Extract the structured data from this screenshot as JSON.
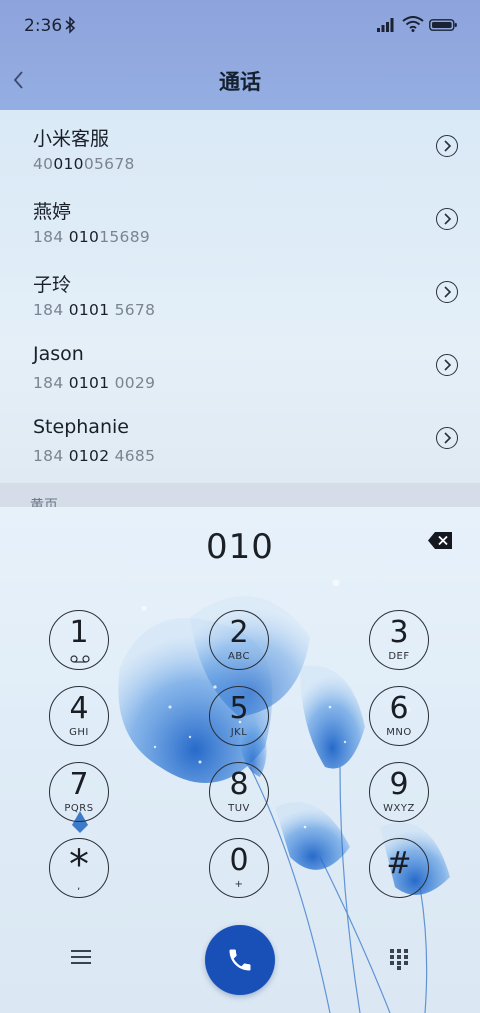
{
  "status_bar": {
    "time": "2:36"
  },
  "header": {
    "title": "通话"
  },
  "contacts": [
    {
      "name": "小米客服",
      "number_pre": "40",
      "number_match": "010",
      "number_post": "05678"
    },
    {
      "name": "燕婷",
      "number_pre": "184 ",
      "number_match": "010",
      "number_post": "15689"
    },
    {
      "name": "子玲",
      "number_pre": "184 ",
      "number_match": "0101",
      "number_post": " 5678"
    },
    {
      "name": "Jason",
      "number_pre": "184 ",
      "number_match": "0101",
      "number_post": " 0029"
    },
    {
      "name": "Stephanie",
      "number_pre": "184 ",
      "number_match": "0102",
      "number_post": " 4685"
    }
  ],
  "section_header": "黄页",
  "dialer": {
    "input": "010",
    "keys": [
      {
        "num": "1",
        "sub": "voicemail-icon"
      },
      {
        "num": "2",
        "sub": "ABC"
      },
      {
        "num": "3",
        "sub": "DEF"
      },
      {
        "num": "4",
        "sub": "GHI"
      },
      {
        "num": "5",
        "sub": "JKL"
      },
      {
        "num": "6",
        "sub": "MNO"
      },
      {
        "num": "7",
        "sub": "PQRS"
      },
      {
        "num": "8",
        "sub": "TUV"
      },
      {
        "num": "9",
        "sub": "WXYZ"
      },
      {
        "num": "*",
        "sub": ","
      },
      {
        "num": "0",
        "sub": "+"
      },
      {
        "num": "#",
        "sub": ""
      }
    ]
  },
  "colors": {
    "accent": "#1850b8",
    "header": "#8ea3dc"
  }
}
